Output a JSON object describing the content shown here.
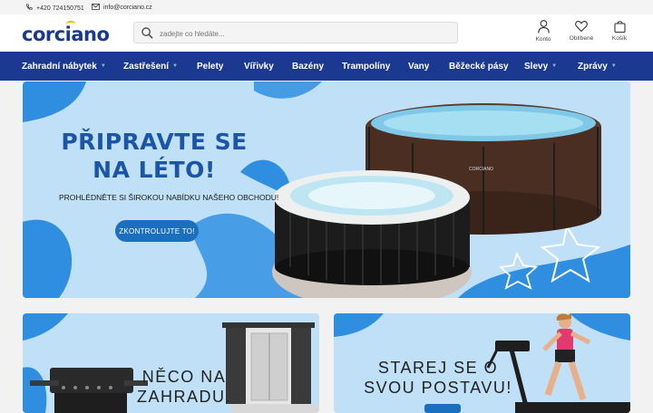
{
  "topbar": {
    "phone": "+420 724150751",
    "email": "info@corciano.cz"
  },
  "header": {
    "logo": "corciano",
    "search_placeholder": "zadejte co hledáte...",
    "account_label": "Konto",
    "favorites_label": "Oblíbené",
    "cart_label": "Košík"
  },
  "nav": {
    "items": [
      {
        "label": "Zahradní nábytek"
      },
      {
        "label": "Zastřešení"
      },
      {
        "label": "Pelety"
      },
      {
        "label": "Vířivky"
      },
      {
        "label": "Bazény"
      },
      {
        "label": "Trampolíny"
      },
      {
        "label": "Vany"
      },
      {
        "label": "Běžecké pásy"
      },
      {
        "label": "Slevy"
      },
      {
        "label": "Zprávy"
      }
    ]
  },
  "banner": {
    "title_line1": "PŘIPRAVTE SE",
    "title_line2": "NA LÉTO!",
    "subtitle": "PROHLÉDNĚTE SI ŠIROKOU NABÍDKU NAŠEHO OBCHODU!",
    "cta": "ZKONTROLUJTE TO!",
    "pool_label": "CORCIANO"
  },
  "cards": [
    {
      "line1": "NĚCO NA",
      "line2": "ZAHRADU."
    },
    {
      "line1": "STAREJ SE O",
      "line2": "SVOU POSTAVU!"
    }
  ],
  "colors": {
    "brand": "#1b3990",
    "accent": "#f5b800",
    "banner_bg": "#bfe0f7",
    "cta": "#1b6fbf"
  }
}
